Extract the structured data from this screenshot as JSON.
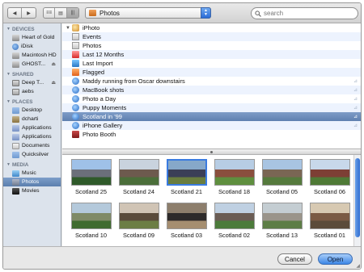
{
  "toolbar": {
    "back_glyph": "◀",
    "forward_glyph": "▶",
    "view_icons": [
      "≡≡",
      "▤",
      "|||"
    ],
    "location": "Photos",
    "search_placeholder": "search"
  },
  "sidebar": {
    "sections": [
      {
        "title": "DEVICES",
        "items": [
          {
            "label": "Heart of Gold",
            "icon": "disk",
            "selected": false
          },
          {
            "label": "iDisk",
            "icon": "globe",
            "selected": false
          },
          {
            "label": "Macintosh HD",
            "icon": "disk",
            "selected": false
          },
          {
            "label": "GHOST...",
            "icon": "disk",
            "selected": false,
            "eject": "⏏"
          }
        ]
      },
      {
        "title": "SHARED",
        "items": [
          {
            "label": "Deep T...",
            "icon": "host",
            "selected": false,
            "eject": "⏏"
          },
          {
            "label": "aebs",
            "icon": "host",
            "selected": false
          }
        ]
      },
      {
        "title": "PLACES",
        "items": [
          {
            "label": "Desktop",
            "icon": "folder",
            "selected": false
          },
          {
            "label": "dcharti",
            "icon": "home",
            "selected": false
          },
          {
            "label": "Applications",
            "icon": "apps",
            "selected": false
          },
          {
            "label": "Applications",
            "icon": "apps",
            "selected": false
          },
          {
            "label": "Documents",
            "icon": "docs",
            "selected": false
          },
          {
            "label": "Quicksilver",
            "icon": "folder",
            "selected": false
          }
        ]
      },
      {
        "title": "MEDIA",
        "items": [
          {
            "label": "Music",
            "icon": "music",
            "selected": false
          },
          {
            "label": "Photos",
            "icon": "photos",
            "selected": true
          },
          {
            "label": "Movies",
            "icon": "movies",
            "selected": false
          }
        ]
      }
    ]
  },
  "list": {
    "rows": [
      {
        "label": "iPhoto",
        "icon": "iphoto",
        "disclosure": "▼",
        "indent": 0,
        "shared": false,
        "selected": false
      },
      {
        "label": "Events",
        "icon": "cal",
        "indent": 1,
        "shared": false,
        "selected": false
      },
      {
        "label": "Photos",
        "icon": "cal",
        "indent": 1,
        "shared": false,
        "selected": false
      },
      {
        "label": "Last 12 Months",
        "icon": "red",
        "indent": 1,
        "shared": false,
        "selected": false
      },
      {
        "label": "Last Import",
        "icon": "dl",
        "indent": 1,
        "shared": false,
        "selected": false
      },
      {
        "label": "Flagged",
        "icon": "flag",
        "indent": 1,
        "shared": false,
        "selected": false
      },
      {
        "label": "Maddy running from Oscar downstairs",
        "icon": "globe",
        "indent": 1,
        "shared": true,
        "selected": false
      },
      {
        "label": "MacBook shots",
        "icon": "globe",
        "indent": 1,
        "shared": true,
        "selected": false
      },
      {
        "label": "Photo a Day",
        "icon": "globe",
        "indent": 1,
        "shared": true,
        "selected": false
      },
      {
        "label": "Puppy Moments",
        "icon": "globe",
        "indent": 1,
        "shared": true,
        "selected": false
      },
      {
        "label": "Scotland in '99",
        "icon": "globe",
        "indent": 1,
        "shared": true,
        "selected": true
      },
      {
        "label": "iPhone Gallery",
        "icon": "globe",
        "indent": 1,
        "shared": true,
        "selected": false
      },
      {
        "label": "Photo Booth",
        "icon": "booth",
        "indent": 0,
        "shared": false,
        "selected": false
      }
    ],
    "share_glyph": "⊿"
  },
  "thumbnails": [
    {
      "caption": "Scotland 25",
      "colors": [
        "#9fc1e8",
        "#6b6f7a",
        "#2f5a2a"
      ],
      "selected": false
    },
    {
      "caption": "Scotland 24",
      "colors": [
        "#c9d3de",
        "#6d5a4e",
        "#4b6e3a"
      ],
      "selected": false
    },
    {
      "caption": "Scotland 21",
      "colors": [
        "#86a8c9",
        "#3b3f57",
        "#6a7d3e"
      ],
      "selected": true
    },
    {
      "caption": "Scotland 18",
      "colors": [
        "#b7cde4",
        "#8a4f3e",
        "#5f8f3f"
      ],
      "selected": false
    },
    {
      "caption": "Scotland 05",
      "colors": [
        "#a8c4e2",
        "#7a6654",
        "#557a3d"
      ],
      "selected": false
    },
    {
      "caption": "Scotland 06",
      "colors": [
        "#c8d8ea",
        "#7d3f35",
        "#4f7a36"
      ],
      "selected": false
    },
    {
      "caption": "Scotland 10",
      "colors": [
        "#b4c9db",
        "#7f8a66",
        "#3f6b2f"
      ],
      "selected": false
    },
    {
      "caption": "Scotland 09",
      "colors": [
        "#d0c4b5",
        "#5a4b3b",
        "#6c7e45"
      ],
      "selected": false
    },
    {
      "caption": "Scotland 03",
      "colors": [
        "#8d7e6c",
        "#2d2a2a",
        "#a58e70"
      ],
      "selected": false
    },
    {
      "caption": "Scotland 02",
      "colors": [
        "#bfd0e2",
        "#6a5c54",
        "#4c7b3b"
      ],
      "selected": false
    },
    {
      "caption": "Scotland 13",
      "colors": [
        "#c4cdd2",
        "#9a948a",
        "#5d7d46"
      ],
      "selected": false
    },
    {
      "caption": "Scotland 01",
      "colors": [
        "#d7c9b2",
        "#7a5a44",
        "#5b4b3a"
      ],
      "selected": false
    }
  ],
  "footer": {
    "cancel_label": "Cancel",
    "open_label": "Open"
  }
}
